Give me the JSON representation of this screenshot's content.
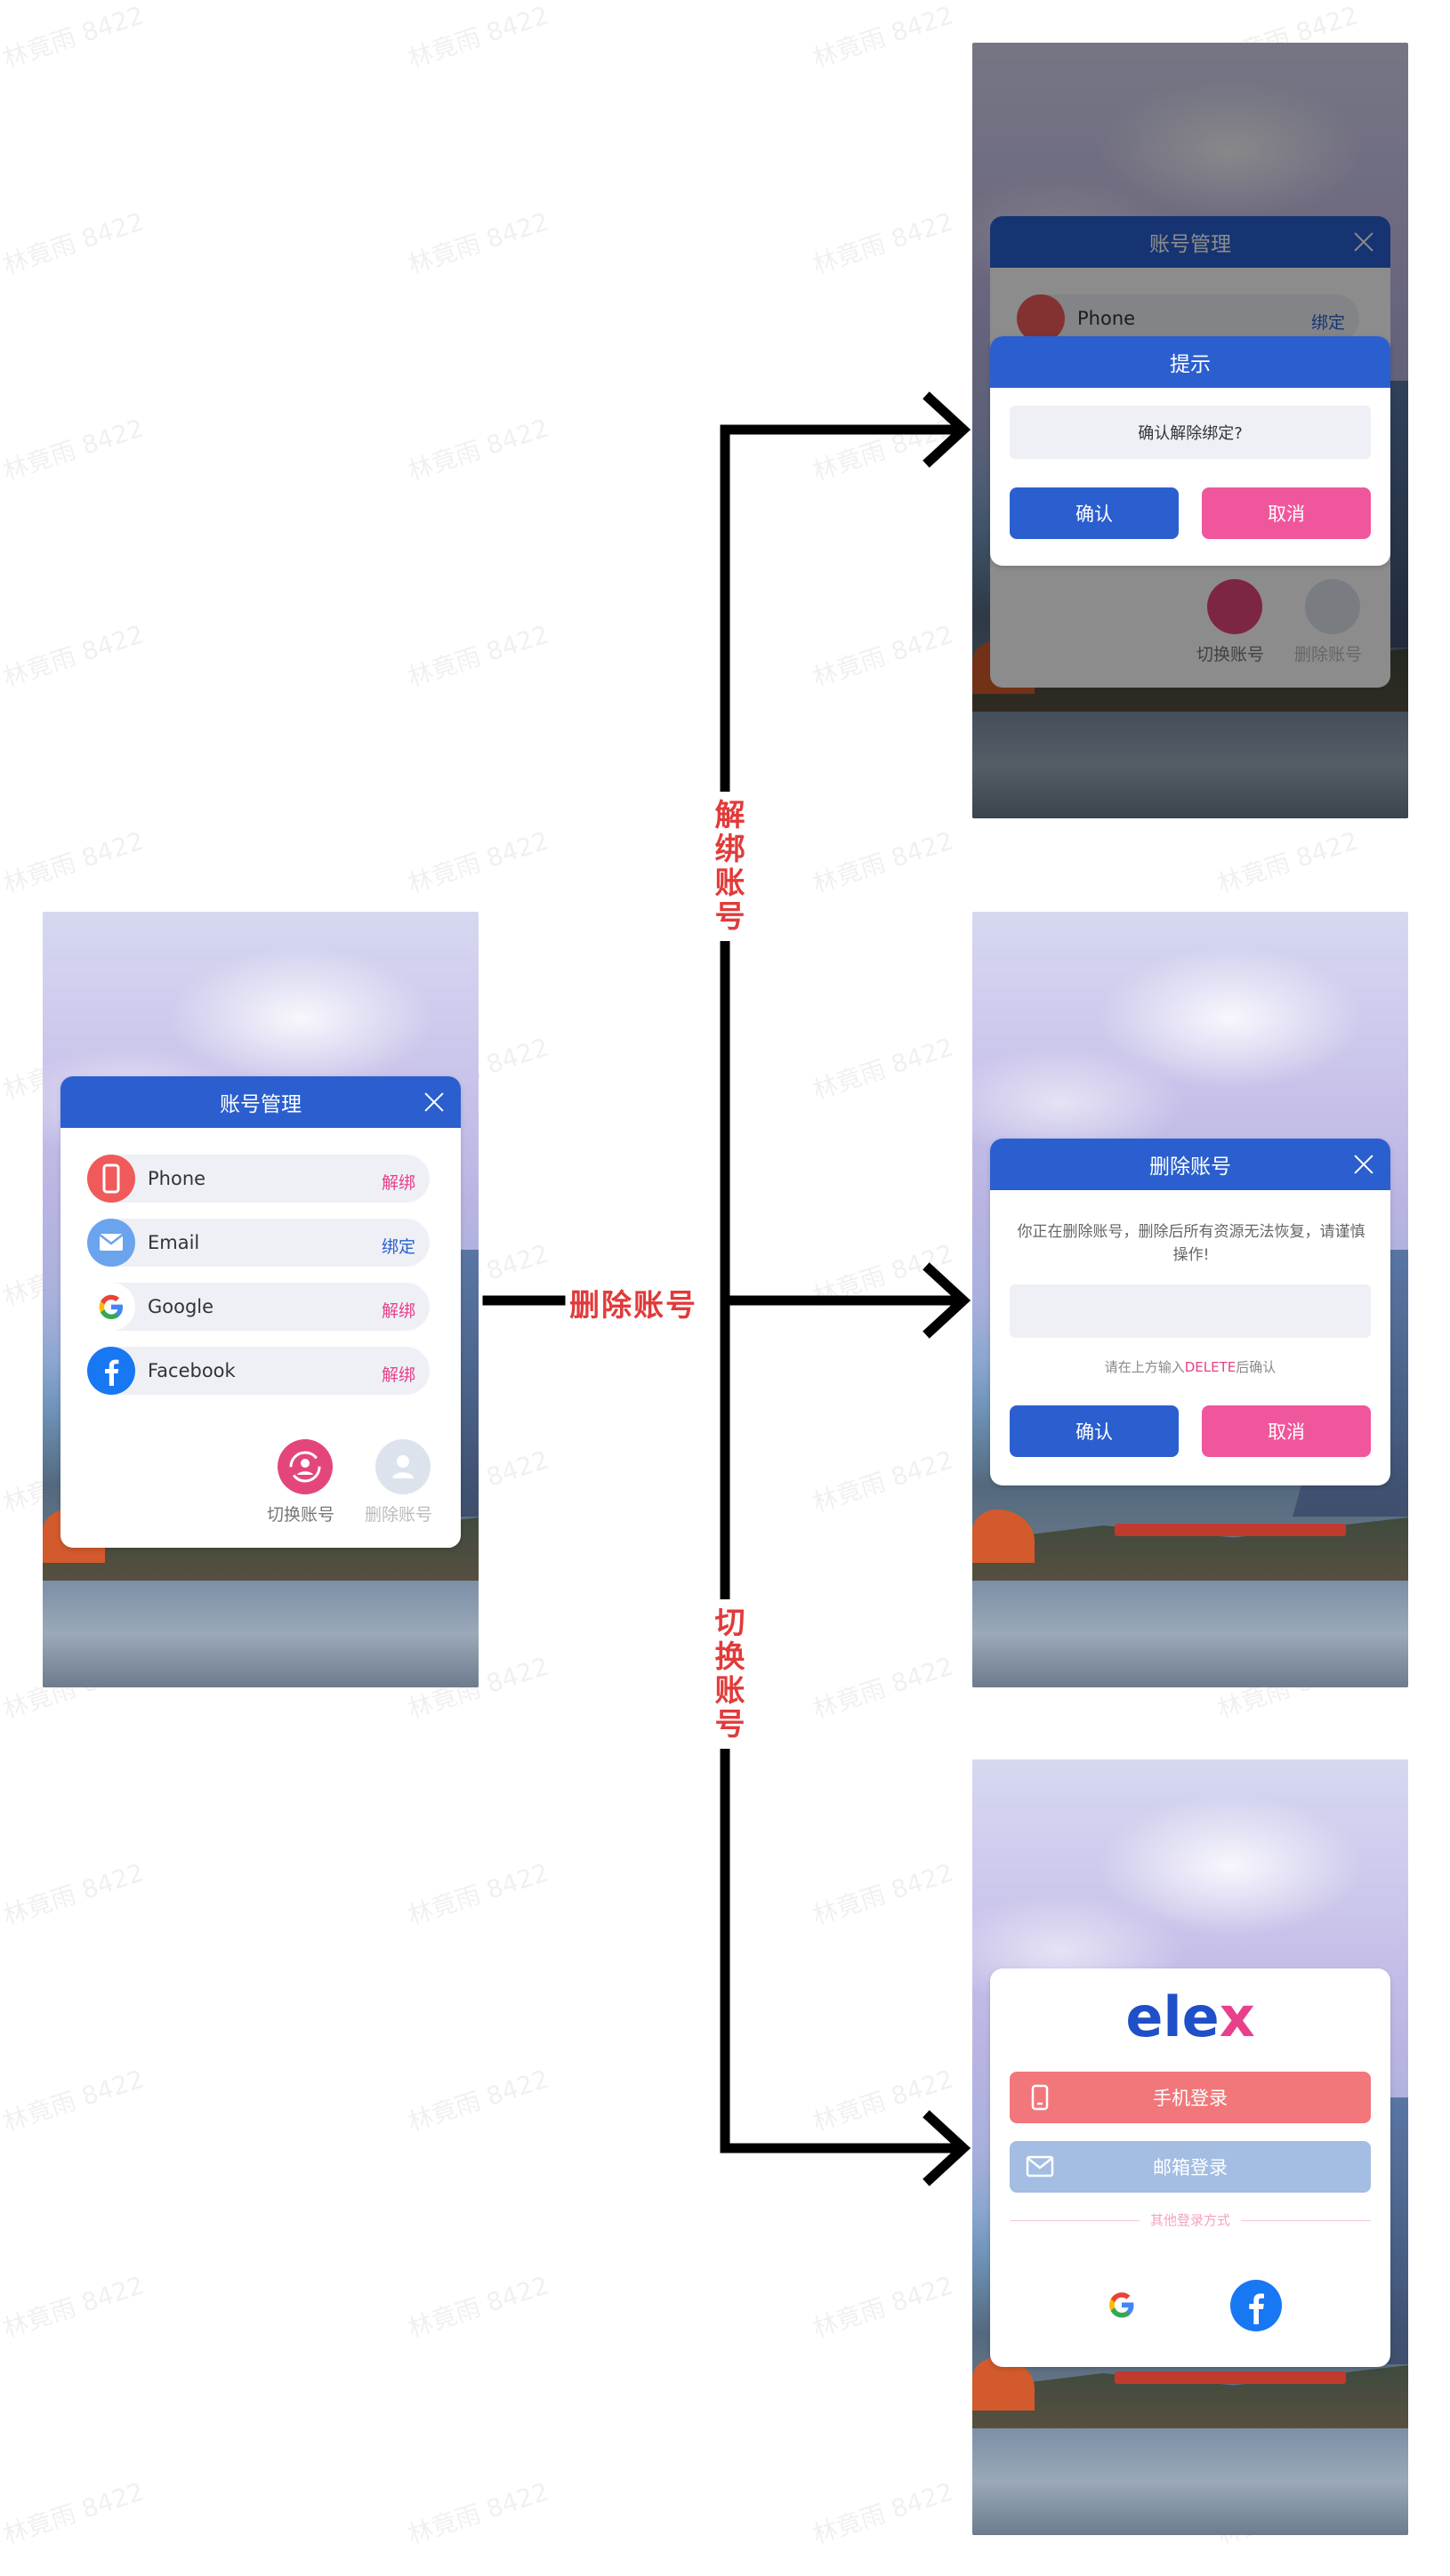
{
  "watermark": "林竟雨 8422",
  "main": {
    "title": "账号管理",
    "rows": [
      {
        "name": "Phone",
        "action": "解绑",
        "action_color": "#e8408a",
        "icon_color": "#f05a5a"
      },
      {
        "name": "Email",
        "action": "绑定",
        "action_color": "#2b5fcf",
        "icon_color": "#6aa3ee"
      },
      {
        "name": "Google",
        "action": "解绑",
        "action_color": "#e8408a",
        "icon_color": "#ffffff"
      },
      {
        "name": "Facebook",
        "action": "解绑",
        "action_color": "#e8408a",
        "icon_color": "#1877f2"
      }
    ],
    "switch_label": "切换账号",
    "delete_label": "删除账号"
  },
  "flow_labels": {
    "unbind": "解绑账号",
    "delete": "删除账号",
    "switch": "切换账号"
  },
  "unbind_screen": {
    "back_title": "账号管理",
    "back_row": "Phone",
    "back_row_action": "绑定",
    "title": "提示",
    "message": "确认解除绑定?",
    "confirm": "确认",
    "cancel": "取消",
    "switch_label": "切换账号",
    "delete_label": "删除账号"
  },
  "delete_screen": {
    "title": "删除账号",
    "warning": "你正在删除账号，删除后所有资源无法恢复，请谨慎操作!",
    "hint_prefix": "请在上方输入",
    "hint_keyword": "DELETE",
    "hint_suffix": "后确认",
    "confirm": "确认",
    "cancel": "取消"
  },
  "login_screen": {
    "logo_el": "el",
    "logo_e": "e",
    "logo_x": "x",
    "phone_login": "手机登录",
    "email_login": "邮箱登录",
    "other": "其他登录方式"
  },
  "colors": {
    "primary": "#2b5fcf",
    "accent": "#f0569b",
    "label_red": "#e23a3a"
  }
}
